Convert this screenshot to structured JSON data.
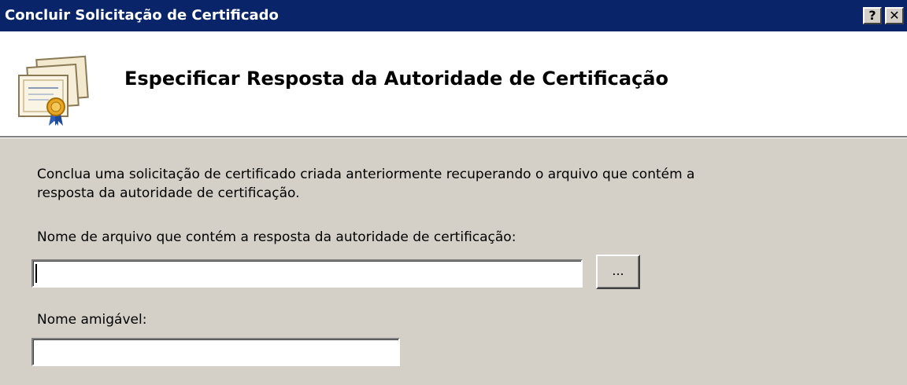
{
  "window": {
    "title": "Concluir Solicitação de Certificado",
    "help_label": "?",
    "close_label": "✕"
  },
  "header": {
    "title": "Especificar Resposta da Autoridade de Certificação",
    "icon": "certificate-icon"
  },
  "content": {
    "description_line1": "Conclua uma solicitação de certificado criada anteriormente recuperando o arquivo que contém a",
    "description_line2": "resposta da autoridade de certificação.",
    "filename_label": "Nome de arquivo que contém a resposta da autoridade de certificação:",
    "filename_value": "",
    "browse_label": "...",
    "friendly_label": "Nome amigável:",
    "friendly_value": ""
  },
  "colors": {
    "titlebar": "#0a246a",
    "dialog_bg": "#d4d0c8",
    "header_bg": "#ffffff"
  }
}
